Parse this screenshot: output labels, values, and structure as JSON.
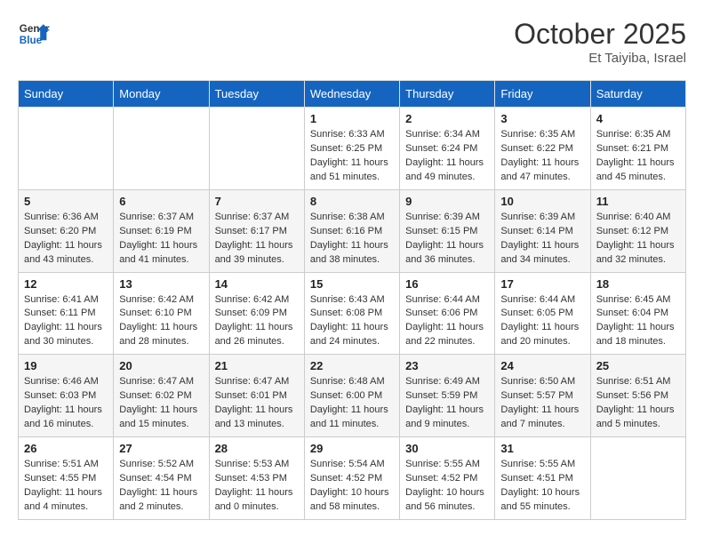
{
  "header": {
    "logo_line1": "General",
    "logo_line2": "Blue",
    "month": "October 2025",
    "location": "Et Taiyiba, Israel"
  },
  "weekdays": [
    "Sunday",
    "Monday",
    "Tuesday",
    "Wednesday",
    "Thursday",
    "Friday",
    "Saturday"
  ],
  "weeks": [
    [
      null,
      null,
      null,
      {
        "day": "1",
        "sunrise": "Sunrise: 6:33 AM",
        "sunset": "Sunset: 6:25 PM",
        "daylight": "Daylight: 11 hours and 51 minutes."
      },
      {
        "day": "2",
        "sunrise": "Sunrise: 6:34 AM",
        "sunset": "Sunset: 6:24 PM",
        "daylight": "Daylight: 11 hours and 49 minutes."
      },
      {
        "day": "3",
        "sunrise": "Sunrise: 6:35 AM",
        "sunset": "Sunset: 6:22 PM",
        "daylight": "Daylight: 11 hours and 47 minutes."
      },
      {
        "day": "4",
        "sunrise": "Sunrise: 6:35 AM",
        "sunset": "Sunset: 6:21 PM",
        "daylight": "Daylight: 11 hours and 45 minutes."
      }
    ],
    [
      {
        "day": "5",
        "sunrise": "Sunrise: 6:36 AM",
        "sunset": "Sunset: 6:20 PM",
        "daylight": "Daylight: 11 hours and 43 minutes."
      },
      {
        "day": "6",
        "sunrise": "Sunrise: 6:37 AM",
        "sunset": "Sunset: 6:19 PM",
        "daylight": "Daylight: 11 hours and 41 minutes."
      },
      {
        "day": "7",
        "sunrise": "Sunrise: 6:37 AM",
        "sunset": "Sunset: 6:17 PM",
        "daylight": "Daylight: 11 hours and 39 minutes."
      },
      {
        "day": "8",
        "sunrise": "Sunrise: 6:38 AM",
        "sunset": "Sunset: 6:16 PM",
        "daylight": "Daylight: 11 hours and 38 minutes."
      },
      {
        "day": "9",
        "sunrise": "Sunrise: 6:39 AM",
        "sunset": "Sunset: 6:15 PM",
        "daylight": "Daylight: 11 hours and 36 minutes."
      },
      {
        "day": "10",
        "sunrise": "Sunrise: 6:39 AM",
        "sunset": "Sunset: 6:14 PM",
        "daylight": "Daylight: 11 hours and 34 minutes."
      },
      {
        "day": "11",
        "sunrise": "Sunrise: 6:40 AM",
        "sunset": "Sunset: 6:12 PM",
        "daylight": "Daylight: 11 hours and 32 minutes."
      }
    ],
    [
      {
        "day": "12",
        "sunrise": "Sunrise: 6:41 AM",
        "sunset": "Sunset: 6:11 PM",
        "daylight": "Daylight: 11 hours and 30 minutes."
      },
      {
        "day": "13",
        "sunrise": "Sunrise: 6:42 AM",
        "sunset": "Sunset: 6:10 PM",
        "daylight": "Daylight: 11 hours and 28 minutes."
      },
      {
        "day": "14",
        "sunrise": "Sunrise: 6:42 AM",
        "sunset": "Sunset: 6:09 PM",
        "daylight": "Daylight: 11 hours and 26 minutes."
      },
      {
        "day": "15",
        "sunrise": "Sunrise: 6:43 AM",
        "sunset": "Sunset: 6:08 PM",
        "daylight": "Daylight: 11 hours and 24 minutes."
      },
      {
        "day": "16",
        "sunrise": "Sunrise: 6:44 AM",
        "sunset": "Sunset: 6:06 PM",
        "daylight": "Daylight: 11 hours and 22 minutes."
      },
      {
        "day": "17",
        "sunrise": "Sunrise: 6:44 AM",
        "sunset": "Sunset: 6:05 PM",
        "daylight": "Daylight: 11 hours and 20 minutes."
      },
      {
        "day": "18",
        "sunrise": "Sunrise: 6:45 AM",
        "sunset": "Sunset: 6:04 PM",
        "daylight": "Daylight: 11 hours and 18 minutes."
      }
    ],
    [
      {
        "day": "19",
        "sunrise": "Sunrise: 6:46 AM",
        "sunset": "Sunset: 6:03 PM",
        "daylight": "Daylight: 11 hours and 16 minutes."
      },
      {
        "day": "20",
        "sunrise": "Sunrise: 6:47 AM",
        "sunset": "Sunset: 6:02 PM",
        "daylight": "Daylight: 11 hours and 15 minutes."
      },
      {
        "day": "21",
        "sunrise": "Sunrise: 6:47 AM",
        "sunset": "Sunset: 6:01 PM",
        "daylight": "Daylight: 11 hours and 13 minutes."
      },
      {
        "day": "22",
        "sunrise": "Sunrise: 6:48 AM",
        "sunset": "Sunset: 6:00 PM",
        "daylight": "Daylight: 11 hours and 11 minutes."
      },
      {
        "day": "23",
        "sunrise": "Sunrise: 6:49 AM",
        "sunset": "Sunset: 5:59 PM",
        "daylight": "Daylight: 11 hours and 9 minutes."
      },
      {
        "day": "24",
        "sunrise": "Sunrise: 6:50 AM",
        "sunset": "Sunset: 5:57 PM",
        "daylight": "Daylight: 11 hours and 7 minutes."
      },
      {
        "day": "25",
        "sunrise": "Sunrise: 6:51 AM",
        "sunset": "Sunset: 5:56 PM",
        "daylight": "Daylight: 11 hours and 5 minutes."
      }
    ],
    [
      {
        "day": "26",
        "sunrise": "Sunrise: 5:51 AM",
        "sunset": "Sunset: 4:55 PM",
        "daylight": "Daylight: 11 hours and 4 minutes."
      },
      {
        "day": "27",
        "sunrise": "Sunrise: 5:52 AM",
        "sunset": "Sunset: 4:54 PM",
        "daylight": "Daylight: 11 hours and 2 minutes."
      },
      {
        "day": "28",
        "sunrise": "Sunrise: 5:53 AM",
        "sunset": "Sunset: 4:53 PM",
        "daylight": "Daylight: 11 hours and 0 minutes."
      },
      {
        "day": "29",
        "sunrise": "Sunrise: 5:54 AM",
        "sunset": "Sunset: 4:52 PM",
        "daylight": "Daylight: 10 hours and 58 minutes."
      },
      {
        "day": "30",
        "sunrise": "Sunrise: 5:55 AM",
        "sunset": "Sunset: 4:52 PM",
        "daylight": "Daylight: 10 hours and 56 minutes."
      },
      {
        "day": "31",
        "sunrise": "Sunrise: 5:55 AM",
        "sunset": "Sunset: 4:51 PM",
        "daylight": "Daylight: 10 hours and 55 minutes."
      },
      null
    ]
  ]
}
